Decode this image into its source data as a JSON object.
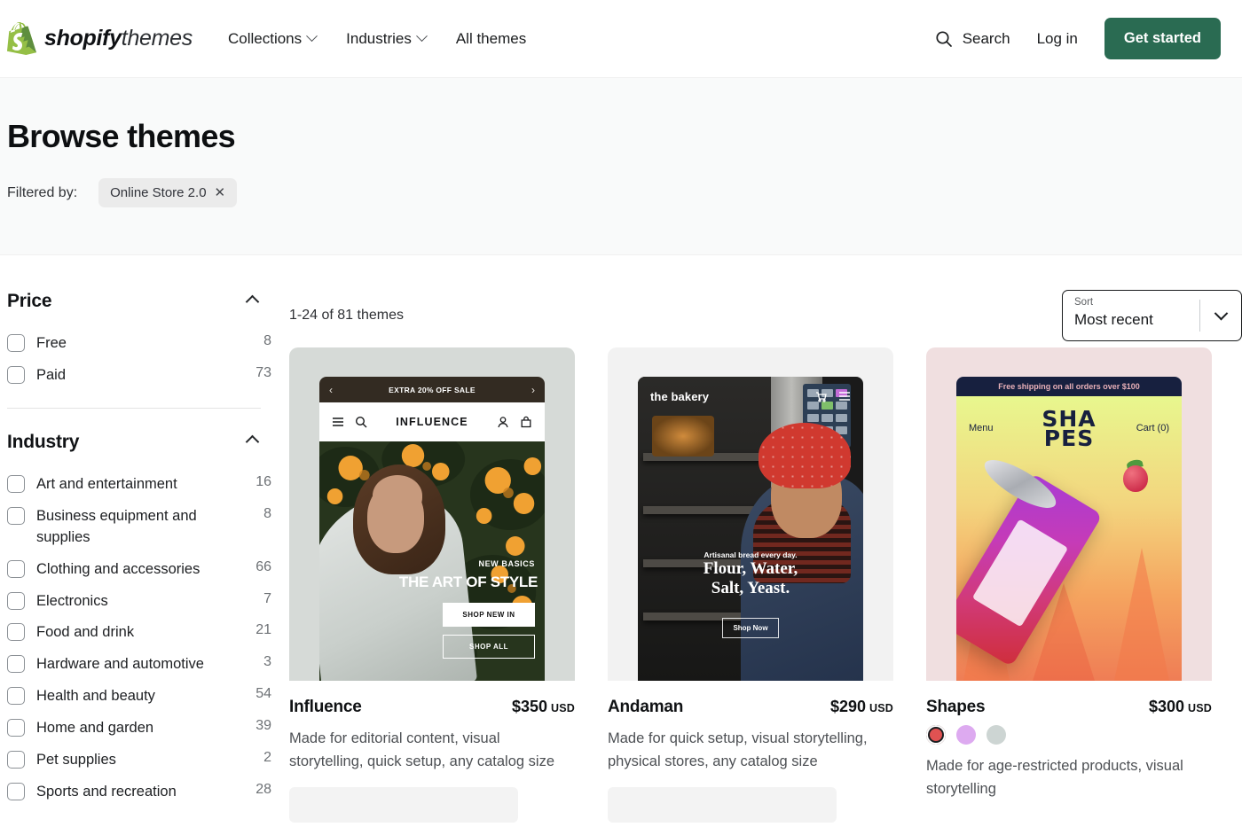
{
  "header": {
    "brand": {
      "primary": "shopify",
      "secondary": "themes",
      "logo_icon": "shopify-bag-logo"
    },
    "nav": [
      {
        "label": "Collections",
        "has_dropdown": true
      },
      {
        "label": "Industries",
        "has_dropdown": true
      },
      {
        "label": "All themes",
        "has_dropdown": false
      }
    ],
    "search_label": "Search",
    "search_icon": "search-icon",
    "login_label": "Log in",
    "cta_label": "Get started",
    "cta_color": "#2a6b52"
  },
  "hero": {
    "title": "Browse themes",
    "filtered_by_label": "Filtered by:",
    "chips": [
      {
        "label": "Online Store 2.0",
        "remove_icon": "close-icon"
      }
    ]
  },
  "sidebar": {
    "facets": [
      {
        "title": "Price",
        "toggle_icon": "chevron-up-icon",
        "options": [
          {
            "label": "Free",
            "count": "8"
          },
          {
            "label": "Paid",
            "count": "73"
          }
        ]
      },
      {
        "title": "Industry",
        "toggle_icon": "chevron-up-icon",
        "options": [
          {
            "label": "Art and entertainment",
            "count": "16"
          },
          {
            "label": "Business equipment and supplies",
            "count": "8"
          },
          {
            "label": "Clothing and accessories",
            "count": "66"
          },
          {
            "label": "Electronics",
            "count": "7"
          },
          {
            "label": "Food and drink",
            "count": "21"
          },
          {
            "label": "Hardware and automotive",
            "count": "3"
          },
          {
            "label": "Health and beauty",
            "count": "54"
          },
          {
            "label": "Home and garden",
            "count": "39"
          },
          {
            "label": "Pet supplies",
            "count": "2"
          },
          {
            "label": "Sports and recreation",
            "count": "28"
          }
        ]
      }
    ]
  },
  "results": {
    "count_text": "1-24 of 81 themes",
    "sort": {
      "label": "Sort",
      "value": "Most recent",
      "caret_icon": "chevron-down-icon"
    },
    "themes": [
      {
        "name": "Influence",
        "price": "$350",
        "currency": "USD",
        "description": "Made for editorial content, visual storytelling, quick setup, any catalog size",
        "card_bg": "#d6dad7",
        "preview": {
          "announcement": "EXTRA 20% OFF SALE",
          "prev_icon": "chevron-left-icon",
          "next_icon": "chevron-right-icon",
          "store_logo": "INFLUENCE",
          "menu_icon": "hamburger-icon",
          "search_icon": "search-icon",
          "account_icon": "account-icon",
          "cart_icon": "bag-icon",
          "kicker": "NEW BASICS",
          "headline": "THE ART OF STYLE",
          "button_primary": "SHOP NEW IN",
          "button_secondary": "SHOP ALL"
        }
      },
      {
        "name": "Andaman",
        "price": "$290",
        "currency": "USD",
        "description": "Made for quick setup, visual storytelling, physical stores, any catalog size",
        "card_bg": "#f2f2f2",
        "preview": {
          "store_logo": "the bakery",
          "cart_icon": "cart-icon",
          "menu_icon": "hamburger-icon",
          "kicker": "Artisanal bread every day.",
          "headline_line1": "Flour, Water,",
          "headline_line2": "Salt, Yeast.",
          "button_primary": "Shop Now"
        }
      },
      {
        "name": "Shapes",
        "price": "$300",
        "currency": "USD",
        "description": "Made for age-restricted products, visual storytelling",
        "card_bg": "#f0dfe0",
        "swatches": [
          {
            "color": "#e05252",
            "selected": true
          },
          {
            "color": "#ddaaf0",
            "selected": false
          },
          {
            "color": "#cdd5d3",
            "selected": false
          }
        ],
        "preview": {
          "announcement": "Free shipping on all orders over $100",
          "menu_label": "Menu",
          "cart_label": "Cart (0)",
          "store_logo_line1": "SHA",
          "store_logo_line2": "PES"
        }
      }
    ]
  }
}
